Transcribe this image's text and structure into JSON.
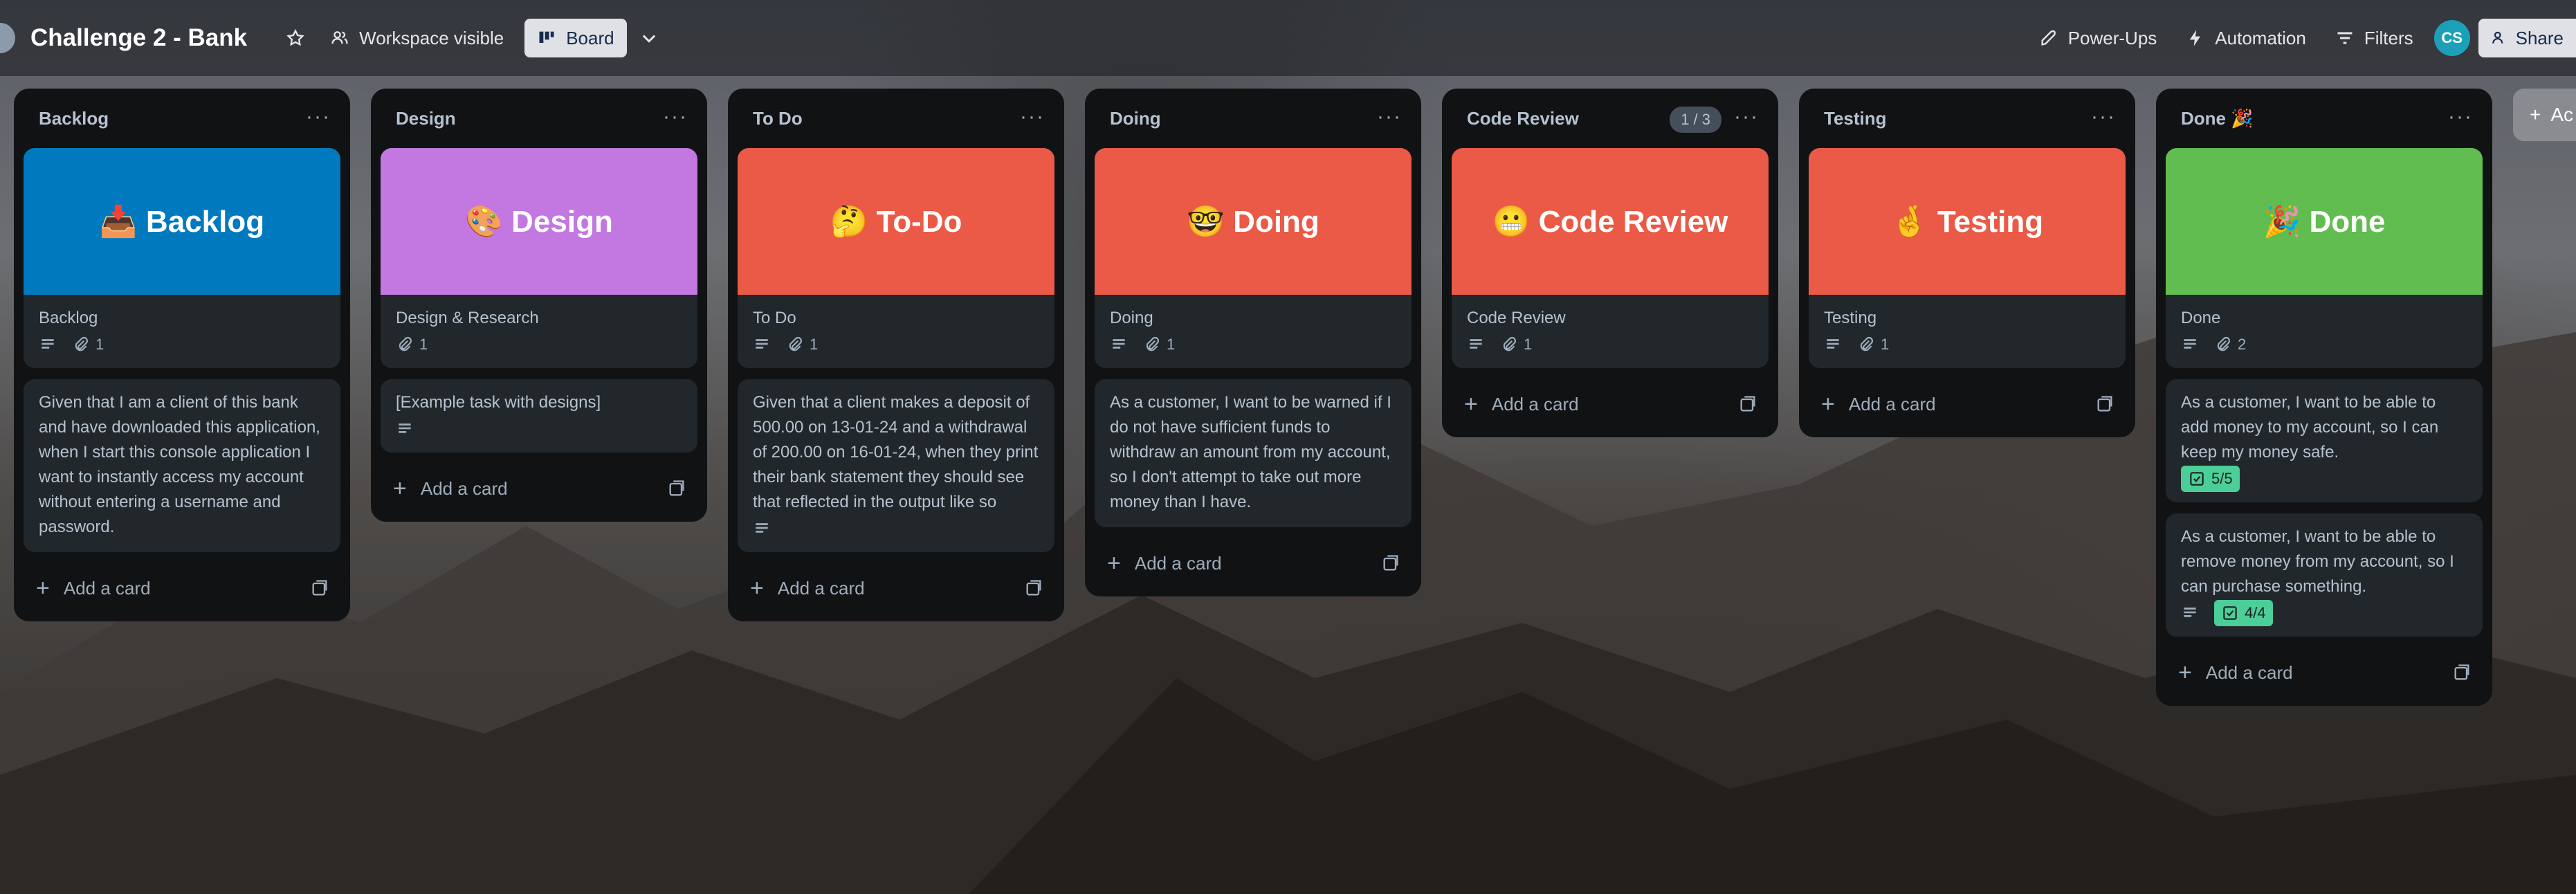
{
  "header": {
    "board_title": "Challenge 2 - Bank",
    "visibility_label": "Workspace visible",
    "view_label": "Board",
    "powerups_label": "Power-Ups",
    "automation_label": "Automation",
    "filters_label": "Filters",
    "avatar_initials": "CS",
    "share_label": "Share"
  },
  "lists": [
    {
      "title": "Backlog",
      "cover_text": "📥 Backlog",
      "cover_color": "#0079bf",
      "card_title": "Backlog",
      "attachments": "1",
      "tasks": [
        {
          "text": "Given that I am a client of this bank and have downloaded this application, when I start this console application I want to instantly access my account without entering a username and password."
        }
      ],
      "add_label": "Add a card"
    },
    {
      "title": "Design",
      "cover_text": "🎨 Design",
      "cover_color": "#c377e0",
      "card_title": "Design & Research",
      "attachments": "1",
      "tasks": [
        {
          "text": "[Example task with designs]"
        }
      ],
      "add_label": "Add a card"
    },
    {
      "title": "To Do",
      "cover_text": "🤔 To-Do",
      "cover_color": "#eb5a46",
      "card_title": "To Do",
      "attachments": "1",
      "tasks": [
        {
          "text": "Given that a client makes a deposit of 500.00 on 13-01-24 and a withdrawal of 200.00 on 16-01-24, when they print their bank statement they should see that reflected in the output like so"
        }
      ],
      "add_label": "Add a card"
    },
    {
      "title": "Doing",
      "cover_text": "🤓 Doing",
      "cover_color": "#eb5a46",
      "card_title": "Doing",
      "attachments": "1",
      "tasks": [
        {
          "text": "As a customer, I want to be warned if I do not have sufficient funds to withdraw an amount from my account, so I don't attempt to take out more money than I have."
        }
      ],
      "add_label": "Add a card"
    },
    {
      "title": "Code Review",
      "count": "1 / 3",
      "cover_text": "😬 Code Review",
      "cover_color": "#eb5a46",
      "card_title": "Code Review",
      "attachments": "1",
      "tasks": [],
      "add_label": "Add a card"
    },
    {
      "title": "Testing",
      "cover_text": "🤞 Testing",
      "cover_color": "#eb5a46",
      "card_title": "Testing",
      "attachments": "1",
      "tasks": [],
      "add_label": "Add a card"
    },
    {
      "title": "Done 🎉",
      "cover_text": "🎉 Done",
      "cover_color": "#61bd4f",
      "card_title": "Done",
      "attachments": "2",
      "tasks": [
        {
          "text": "As a customer, I want to be able to add money to my account, so I can keep my money safe.",
          "checklist": "5/5"
        },
        {
          "text": "As a customer, I want to be able to remove money from my account, so I can purchase something.",
          "checklist": "4/4"
        }
      ],
      "add_label": "Add a card"
    }
  ],
  "add_list_label": "Ac"
}
